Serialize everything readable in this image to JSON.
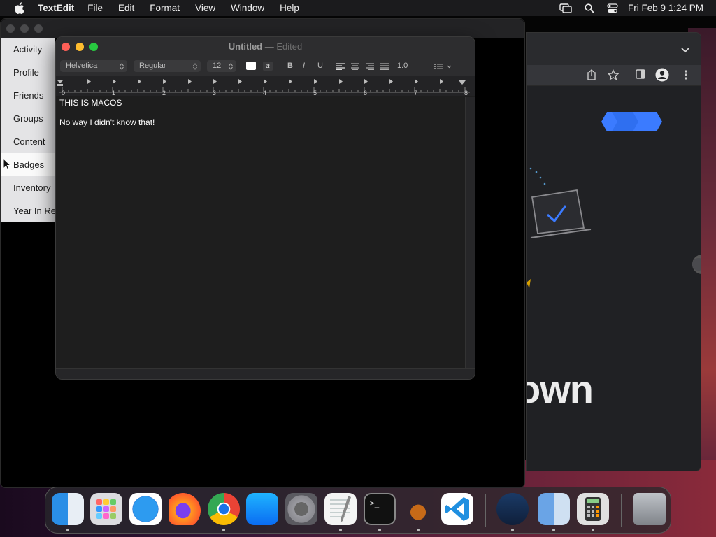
{
  "menubar": {
    "app_name": "TextEdit",
    "items": [
      "File",
      "Edit",
      "Format",
      "View",
      "Window",
      "Help"
    ],
    "clock": "Fri Feb 9  1:24 PM"
  },
  "back_sidebar": {
    "items": [
      "Activity",
      "Profile",
      "Friends",
      "Groups",
      "Content",
      "Badges",
      "Inventory",
      "Year In Re"
    ],
    "active_index": 5
  },
  "browser": {
    "headline": "own",
    "accent": "#3b7bff"
  },
  "textedit": {
    "title": "Untitled",
    "separator": "—",
    "status": "Edited",
    "font_family": "Helvetica",
    "font_style": "Regular",
    "font_size": "12",
    "line_spacing": "1.0",
    "bold_label": "B",
    "italic_label": "I",
    "underline_label": "U",
    "ruler_labels": [
      "0",
      "1",
      "2",
      "3",
      "4",
      "5",
      "6",
      "7",
      "8"
    ],
    "document_lines": [
      "THIS IS MACOS",
      "No way I didn't know that!"
    ]
  },
  "dock": {
    "apps": [
      {
        "name": "Finder",
        "icon": "finder-icon",
        "running": true
      },
      {
        "name": "Launchpad",
        "icon": "launchpad-icon",
        "running": false
      },
      {
        "name": "Safari",
        "icon": "safari-icon",
        "running": false
      },
      {
        "name": "Firefox",
        "icon": "firefox-icon",
        "running": false
      },
      {
        "name": "Chrome",
        "icon": "chrome-icon",
        "running": true
      },
      {
        "name": "App Store",
        "icon": "app-store-icon",
        "running": false
      },
      {
        "name": "System Preferences",
        "icon": "system-preferences-icon",
        "running": false
      },
      {
        "name": "TextEdit",
        "icon": "textedit-icon",
        "running": true
      },
      {
        "name": "Terminal",
        "icon": "terminal-icon",
        "running": true
      },
      {
        "name": "GarageBand",
        "icon": "garageband-icon",
        "running": true
      },
      {
        "name": "VS Code",
        "icon": "vscode-icon",
        "running": false
      },
      {
        "name": "Steam",
        "icon": "steam-icon",
        "running": true
      },
      {
        "name": "Migration Assistant",
        "icon": "migration-assistant-icon",
        "running": true
      },
      {
        "name": "Calculator",
        "icon": "calculator-icon",
        "running": true
      },
      {
        "name": "Trash",
        "icon": "trash-icon",
        "running": false
      }
    ]
  }
}
